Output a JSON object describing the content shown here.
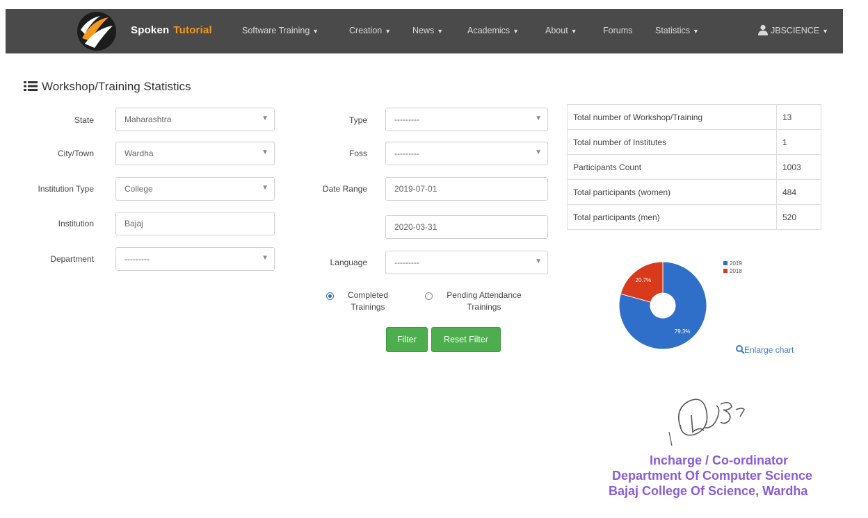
{
  "navbar": {
    "brand_first": "Spoken",
    "brand_second": "Tutorial",
    "items": [
      {
        "label": "Software Training"
      },
      {
        "label": "Creation"
      },
      {
        "label": "News"
      },
      {
        "label": "Academics"
      },
      {
        "label": "About"
      },
      {
        "label": "Forums"
      },
      {
        "label": "Statistics"
      }
    ],
    "user": "JBSCIENCE",
    "brand_accent": "#f39a1d",
    "background": "#4a4a4a"
  },
  "page": {
    "title": "Workshop/Training Statistics",
    "title_icon": "list-icon"
  },
  "filters": {
    "state": {
      "label": "State",
      "value": "Maharashtra"
    },
    "city": {
      "label": "City/Town",
      "value": "Wardha"
    },
    "institution_type": {
      "label": "Institution Type",
      "value": "College"
    },
    "institution": {
      "label": "Institution",
      "value": "Bajaj"
    },
    "department": {
      "label": "Department",
      "value": "---------"
    },
    "type": {
      "label": "Type",
      "value": "---------"
    },
    "foss": {
      "label": "Foss",
      "value": "---------"
    },
    "date_range": {
      "label": "Date Range",
      "from": "2019-07-01",
      "to": "2020-03-31"
    },
    "language": {
      "label": "Language",
      "value": "---------"
    },
    "radio_completed": "Completed Trainings",
    "radio_pending": "Pending Attendance Trainings",
    "filter_button": "Filter",
    "reset_button": "Reset Filter"
  },
  "stats": [
    {
      "label": "Total number of Workshop/Training",
      "value": "13"
    },
    {
      "label": "Total number of Institutes",
      "value": "1"
    },
    {
      "label": "Participants Count",
      "value": "1003"
    },
    {
      "label": "Total participants (women)",
      "value": "484"
    },
    {
      "label": "Total participants (men)",
      "value": "520"
    }
  ],
  "chart_data": {
    "type": "pie",
    "donut": true,
    "series": [
      {
        "name": "2019",
        "value": 79.3,
        "label": "79.3%",
        "color": "#2f6fc9"
      },
      {
        "name": "2018",
        "value": 20.7,
        "label": "20.7%",
        "color": "#d93a1b"
      }
    ],
    "legend_position": "top-right",
    "enlarge_label": "Enlarge chart"
  },
  "stamp": {
    "line1": "Incharge / Co-ordinator",
    "line2": "Department Of Computer Science",
    "line3": "Bajaj College Of Science, Wardha",
    "color": "#8a5bd6"
  }
}
